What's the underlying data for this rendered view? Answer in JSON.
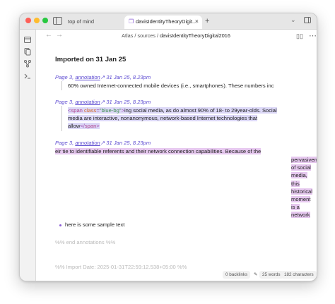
{
  "tabs": [
    {
      "label": "top of mind"
    },
    {
      "label": "davisIdentityTheoryDigit...",
      "close": "×"
    }
  ],
  "new_tab": "+",
  "breadcrumb": {
    "parts": [
      "Atlas",
      "sources",
      "davisIdentityTheoryDigital2016"
    ],
    "sep": " / "
  },
  "heading": "Imported on 31 Jan 25",
  "annotations": [
    {
      "page": "Page 3,",
      "link": "annotation",
      "date": "31 Jan 25, 8.23pm",
      "lines": [
        "60% owned Internet-connected mobile devices (i.e.,  smartphones). These numbers inc"
      ]
    },
    {
      "page": "Page 3,",
      "link": "annotation",
      "date": "31 Jan 25, 8.23pm",
      "code": {
        "open_punc": "<",
        "open_name": "span",
        "attr": "class",
        "eq": "=",
        "str": "\"blue-bg\"",
        "open_close": ">",
        "text1": "ing social media, as do almost 90% of 18- to 29year-olds. Social",
        "text2": "media are interactive, nonanonymous, network-based  Internet technologies that",
        "text3": "allow",
        "close_open": "</",
        "close_name": "span",
        "close_end": ">"
      }
    },
    {
      "page": "Page 3,",
      "link": "annotation",
      "date": "31 Jan 25, 8.23pm",
      "line1": "eir tie to identifiable referents and their network connection capabilities. Because of the",
      "words": [
        "pervasiveness",
        "of social",
        "media,",
        "this",
        "historical",
        "moment",
        "is a",
        "network"
      ]
    }
  ],
  "bullet": "here is some sample text",
  "end_comment": "%% end annotations %%",
  "import_comment": "%% Import Date: 2025-01-31T22:59:12.538+05:00 %%",
  "status": {
    "backlinks": "0 backlinks",
    "words": "25 words",
    "chars": "182 characters"
  },
  "colors": {
    "accent": "#5d4bd1",
    "highlight_blue": "#dcd8f7",
    "highlight_purple": "#e6c8ef"
  },
  "icons": {
    "files": "file-icon",
    "search": "search-icon",
    "graph": "graph-icon",
    "terminal": "terminal-icon"
  }
}
